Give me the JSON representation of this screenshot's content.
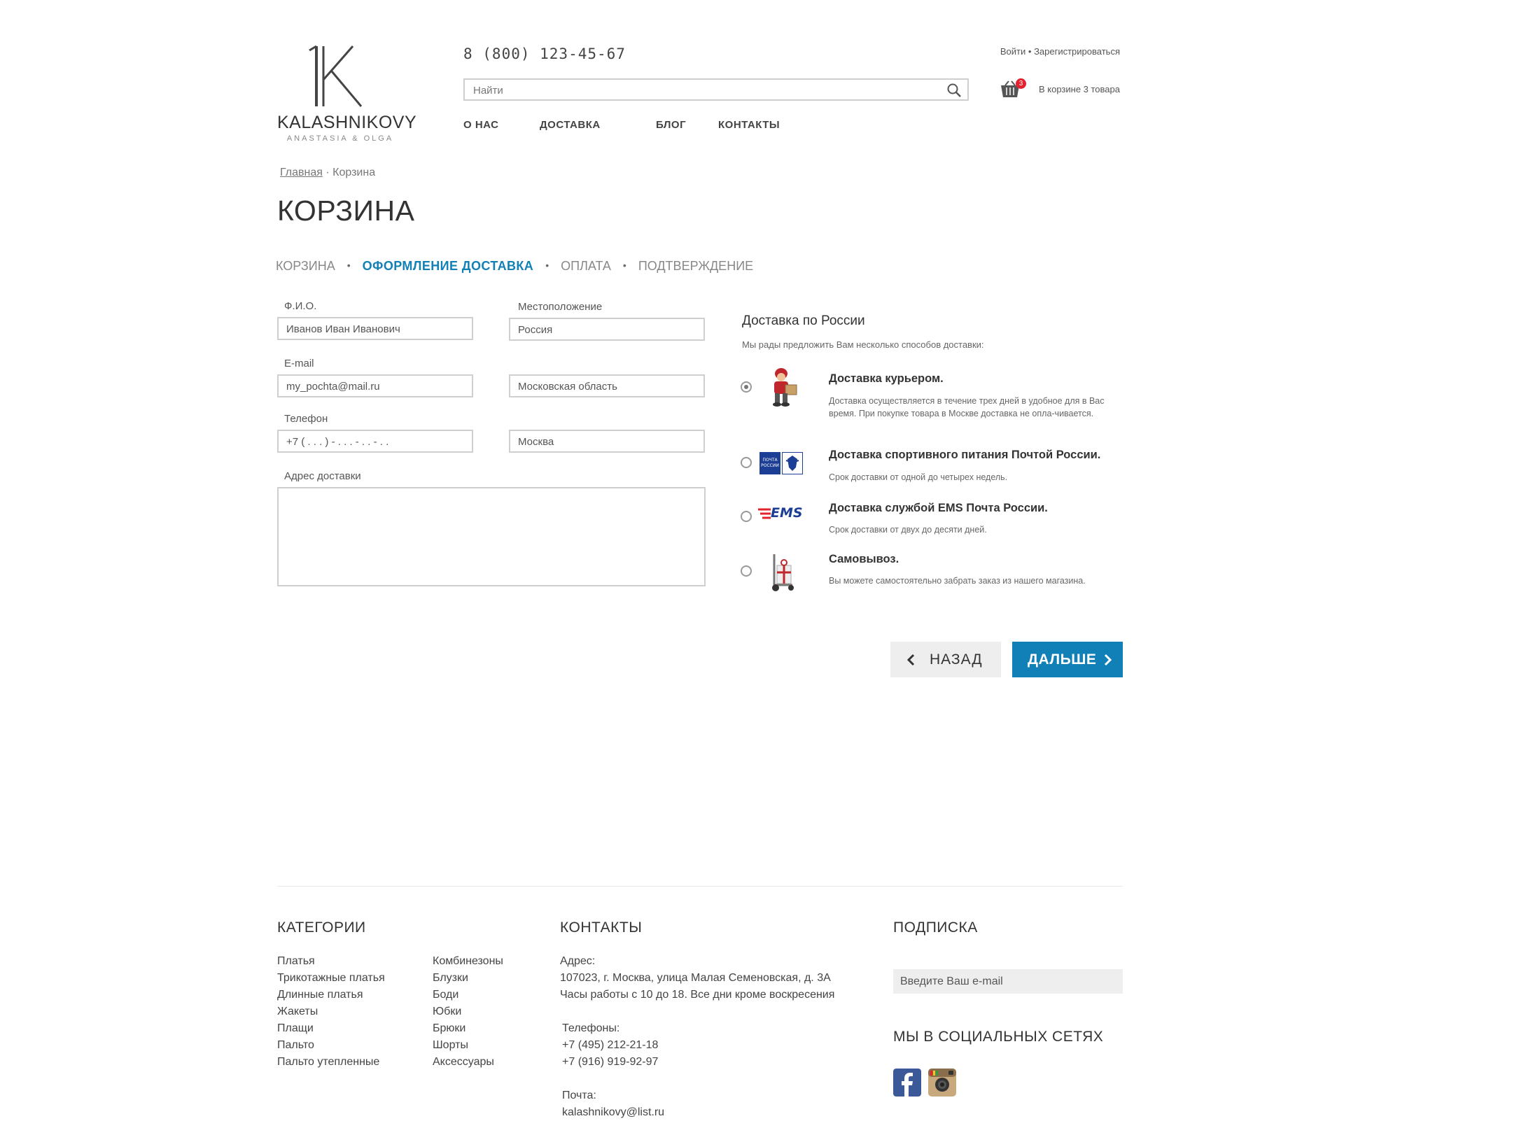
{
  "header": {
    "logo_text": "KALASHNIKOVY",
    "logo_sub": "ANASTASIA & OLGA",
    "phone": "8 (800) 123-45-67",
    "search_placeholder": "Найти",
    "nav": [
      "О НАС",
      "ДОСТАВКА",
      "БЛОГ",
      "КОНТАКТЫ"
    ],
    "login": "Войти",
    "sep": "•",
    "register": "Зарегистрироваться",
    "cart_count": "3",
    "cart_text": "В корзине 3 товара"
  },
  "breadcrumb": {
    "home": "Главная",
    "sep": "·",
    "current": "Корзина"
  },
  "page_title": "КОРЗИНА",
  "steps": {
    "items": [
      "КОРЗИНА",
      "ОФОРМЛЕНИЕ ДОСТАВКА",
      "ОПЛАТА",
      "ПОДТВЕРЖДЕНИЕ"
    ],
    "dot": "•",
    "active": 1
  },
  "form": {
    "fio_label": "Ф.И.О.",
    "fio_value": "Иванов Иван Иванович",
    "email_label": "E-mail",
    "email_value": "my_pochta@mail.ru",
    "phone_label": "Телефон",
    "phone_value": "+7 ( . . . ) - . . . - . . - . .",
    "address_label": "Адрес доставки",
    "address_value": "",
    "location_label": "Местоположение",
    "country_value": "Россия",
    "region_value": "Московская область",
    "city_value": "Москва"
  },
  "delivery": {
    "title": "Доставка по России",
    "intro": "Мы рады предложить Вам несколько способов доставки:",
    "options": [
      {
        "title": "Доставка курьером.",
        "desc": "Доставка осуществляется в течение трех дней в удобное для в Вас время. При покупке товара в Москве доставка не опла-чивается.",
        "checked": true,
        "icon": "courier-icon"
      },
      {
        "title": "Доставка спортивного питания Почтой России.",
        "desc": "Срок доставки от одной до четырех недель.",
        "checked": false,
        "icon": "russian-post-icon",
        "icon_text": "ПОЧТА РОССИИ"
      },
      {
        "title": "Доставка службой EMS Почта России.",
        "desc": "Срок доставки от двух до десяти дней.",
        "checked": false,
        "icon": "ems-icon",
        "icon_text": "EMS"
      },
      {
        "title": "Самовывоз.",
        "desc": "Вы можете самостоятельно забрать заказ из нашего магазина.",
        "checked": false,
        "icon": "hand-truck-icon"
      }
    ]
  },
  "buttons": {
    "back": "НАЗАД",
    "next": "ДАЛЬШЕ"
  },
  "footer": {
    "categories_title": "КАТЕГОРИИ",
    "categories_col1": [
      "Платья",
      "Трикотажные платья",
      "Длинные платья",
      "Жакеты",
      "Плащи",
      "Пальто",
      "Пальто утепленные"
    ],
    "categories_col2": [
      "Комбинезоны",
      "Блузки",
      "Боди",
      "Юбки",
      "Брюки",
      "Шорты",
      "Аксессуары"
    ],
    "contacts_title": "КОНТАКТЫ",
    "address_label": "Адрес:",
    "address_line1": "107023, г. Москва, улица Малая Семеновская, д. 3А",
    "address_line2": "Часы работы с 10 до 18. Все дни кроме воскресения",
    "phones_label": "Телефоны:",
    "phone1": "+7 (495) 212-21-18",
    "phone2": "+7 (916) 919-92-97",
    "mail_label": "Почта:",
    "mail": "kalashnikovy@list.ru",
    "subscribe_title": "ПОДПИСКА",
    "subscribe_placeholder": "Введите Ваш e-mail",
    "social_title": "МЫ В СОЦИАЛЬНЫХ СЕТЯХ"
  },
  "colors": {
    "accent": "#1180b6",
    "badge": "#e4212e",
    "facebook": "#3b5998"
  }
}
